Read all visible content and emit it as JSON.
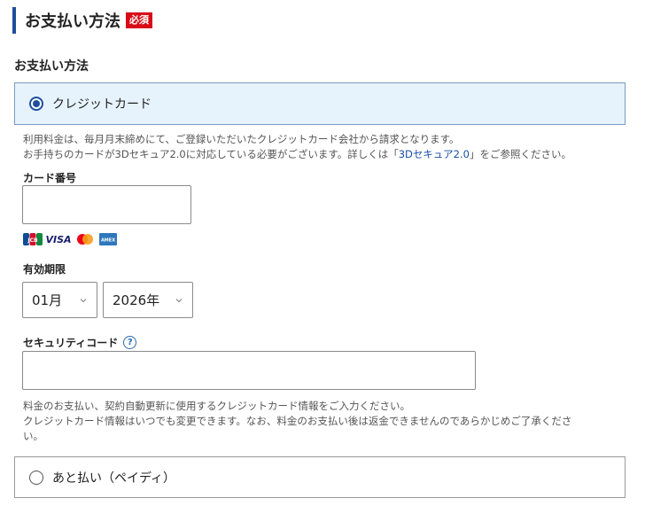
{
  "section": {
    "title": "お支払い方法",
    "required_badge": "必須"
  },
  "sub_label": "お支払い方法",
  "option_credit": {
    "label": "クレジットカード"
  },
  "credit_note": {
    "line1": "利用料金は、毎月月末締めにて、ご登録いただいたクレジットカード会社から請求となります。",
    "line2_pre": "お手持ちのカードが3Dセキュア2.0に対応している必要がございます。詳しくは「",
    "line2_link": "3Dセキュア2.0",
    "line2_post": "」をご参照ください。"
  },
  "card_number": {
    "label": "カード番号",
    "value": ""
  },
  "card_brands": [
    "JCB",
    "VISA",
    "Mastercard",
    "AMEX"
  ],
  "expiry": {
    "label": "有効期限",
    "month": "01月",
    "year": "2026年"
  },
  "security": {
    "label": "セキュリティコード",
    "help": "?",
    "value": ""
  },
  "security_note": {
    "line1": "料金のお支払い、契約自動更新に使用するクレジットカード情報をご入力ください。",
    "line2": "クレジットカード情報はいつでも変更できます。なお、料金のお支払い後は返金できませんのであらかじめご了承くださ",
    "line3": "い。"
  },
  "option_paidy": {
    "label": "あと払い（ペイディ）"
  },
  "colors": {
    "accent": "#1e4f9c",
    "badge": "#d80c18",
    "selected_bg": "#e6f3fd",
    "link": "#1a4fa5"
  }
}
